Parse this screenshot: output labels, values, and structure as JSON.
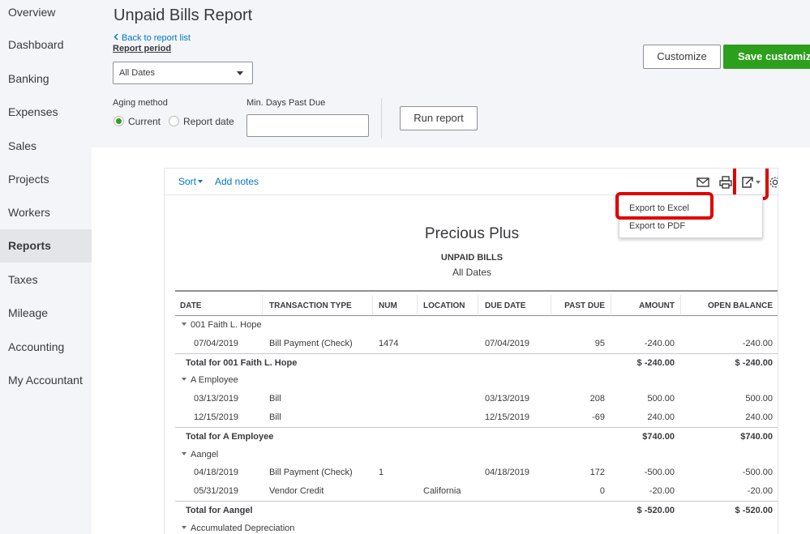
{
  "sidebar": {
    "items": [
      {
        "label": "Overview"
      },
      {
        "label": "Dashboard"
      },
      {
        "label": "Banking"
      },
      {
        "label": "Expenses"
      },
      {
        "label": "Sales"
      },
      {
        "label": "Projects"
      },
      {
        "label": "Workers"
      },
      {
        "label": "Reports",
        "active": true
      },
      {
        "label": "Taxes"
      },
      {
        "label": "Mileage"
      },
      {
        "label": "Accounting"
      },
      {
        "label": "My Accountant"
      }
    ]
  },
  "header": {
    "title": "Unpaid Bills Report",
    "back_link": "Back to report list",
    "report_period_label": "Report period",
    "report_period_value": "All Dates",
    "aging_method_label": "Aging method",
    "aging_options": [
      {
        "label": "Current",
        "selected": true
      },
      {
        "label": "Report date",
        "selected": false
      }
    ],
    "min_days_label": "Min. Days Past Due",
    "min_days_value": "",
    "run_report": "Run report",
    "customize": "Customize",
    "save_customization": "Save customizat"
  },
  "toolbar": {
    "sort": "Sort",
    "add_notes": "Add notes",
    "icons": [
      "email-icon",
      "print-icon",
      "export-icon",
      "settings-gear-icon"
    ]
  },
  "export_menu": {
    "items": [
      "Export to Excel",
      "Export to PDF"
    ]
  },
  "report": {
    "company": "Precious Plus",
    "title": "UNPAID BILLS",
    "subtitle": "All Dates",
    "columns": [
      "DATE",
      "TRANSACTION TYPE",
      "NUM",
      "LOCATION",
      "DUE DATE",
      "PAST DUE",
      "AMOUNT",
      "OPEN BALANCE"
    ],
    "rows": [
      {
        "kind": "group",
        "label": "001 Faith L. Hope"
      },
      {
        "kind": "detail",
        "date": "07/04/2019",
        "type": "Bill Payment (Check)",
        "num": "1474",
        "location": "",
        "due": "07/04/2019",
        "past_due": "95",
        "amount": "-240.00",
        "balance": "-240.00"
      },
      {
        "kind": "total",
        "label": "Total for 001 Faith L. Hope",
        "amount": "$ -240.00",
        "balance": "$ -240.00"
      },
      {
        "kind": "group",
        "label": "A Employee"
      },
      {
        "kind": "detail",
        "date": "03/13/2019",
        "type": "Bill",
        "num": "",
        "location": "",
        "due": "03/13/2019",
        "past_due": "208",
        "amount": "500.00",
        "balance": "500.00"
      },
      {
        "kind": "detail",
        "date": "12/15/2019",
        "type": "Bill",
        "num": "",
        "location": "",
        "due": "12/15/2019",
        "past_due": "-69",
        "amount": "240.00",
        "balance": "240.00"
      },
      {
        "kind": "total",
        "label": "Total for A Employee",
        "amount": "$740.00",
        "balance": "$740.00"
      },
      {
        "kind": "group",
        "label": "Aangel"
      },
      {
        "kind": "detail",
        "date": "04/18/2019",
        "type": "Bill Payment (Check)",
        "num": "1",
        "location": "",
        "due": "04/18/2019",
        "past_due": "172",
        "amount": "-500.00",
        "balance": "-500.00"
      },
      {
        "kind": "detail",
        "date": "05/31/2019",
        "type": "Vendor Credit",
        "num": "",
        "location": "California",
        "due": "",
        "past_due": "0",
        "amount": "-20.00",
        "balance": "-20.00"
      },
      {
        "kind": "total",
        "label": "Total for Aangel",
        "amount": "$ -520.00",
        "balance": "$ -520.00"
      },
      {
        "kind": "group",
        "label": "Accumulated Depreciation"
      }
    ]
  },
  "colors": {
    "accent_green": "#2ca01c",
    "link_blue": "#0077c5",
    "highlight_red": "#e00000"
  }
}
